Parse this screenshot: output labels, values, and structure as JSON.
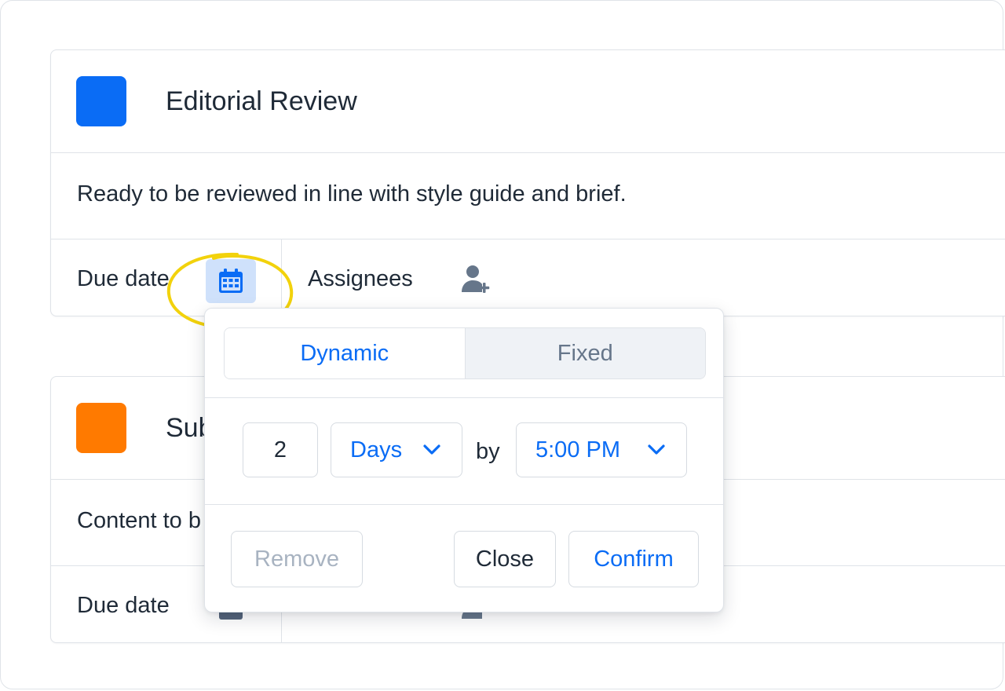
{
  "cards": [
    {
      "title": "Editorial Review",
      "color": "#0a6cf5",
      "description": "Ready to be reviewed in line with style guide and brief.",
      "due_label": "Due date",
      "assignees_label": "Assignees"
    },
    {
      "title": "Sub",
      "color": "#ff7a00",
      "description": "Content to b",
      "due_label": "Due date",
      "assignees_label": ""
    }
  ],
  "icons": {
    "calendar": "calendar-icon",
    "add_user": "add-user-icon",
    "chevron": "chevron-down-icon"
  },
  "popover": {
    "tabs": {
      "dynamic": "Dynamic",
      "fixed": "Fixed",
      "selected": "Dynamic"
    },
    "amount": "2",
    "unit": "Days",
    "by_label": "by",
    "time": "5:00 PM",
    "buttons": {
      "remove": "Remove",
      "close": "Close",
      "confirm": "Confirm"
    }
  },
  "colors": {
    "accent": "#0a6cf5",
    "highlight": "#f2d20c",
    "calendar_active_bg": "#cfe1fb"
  }
}
